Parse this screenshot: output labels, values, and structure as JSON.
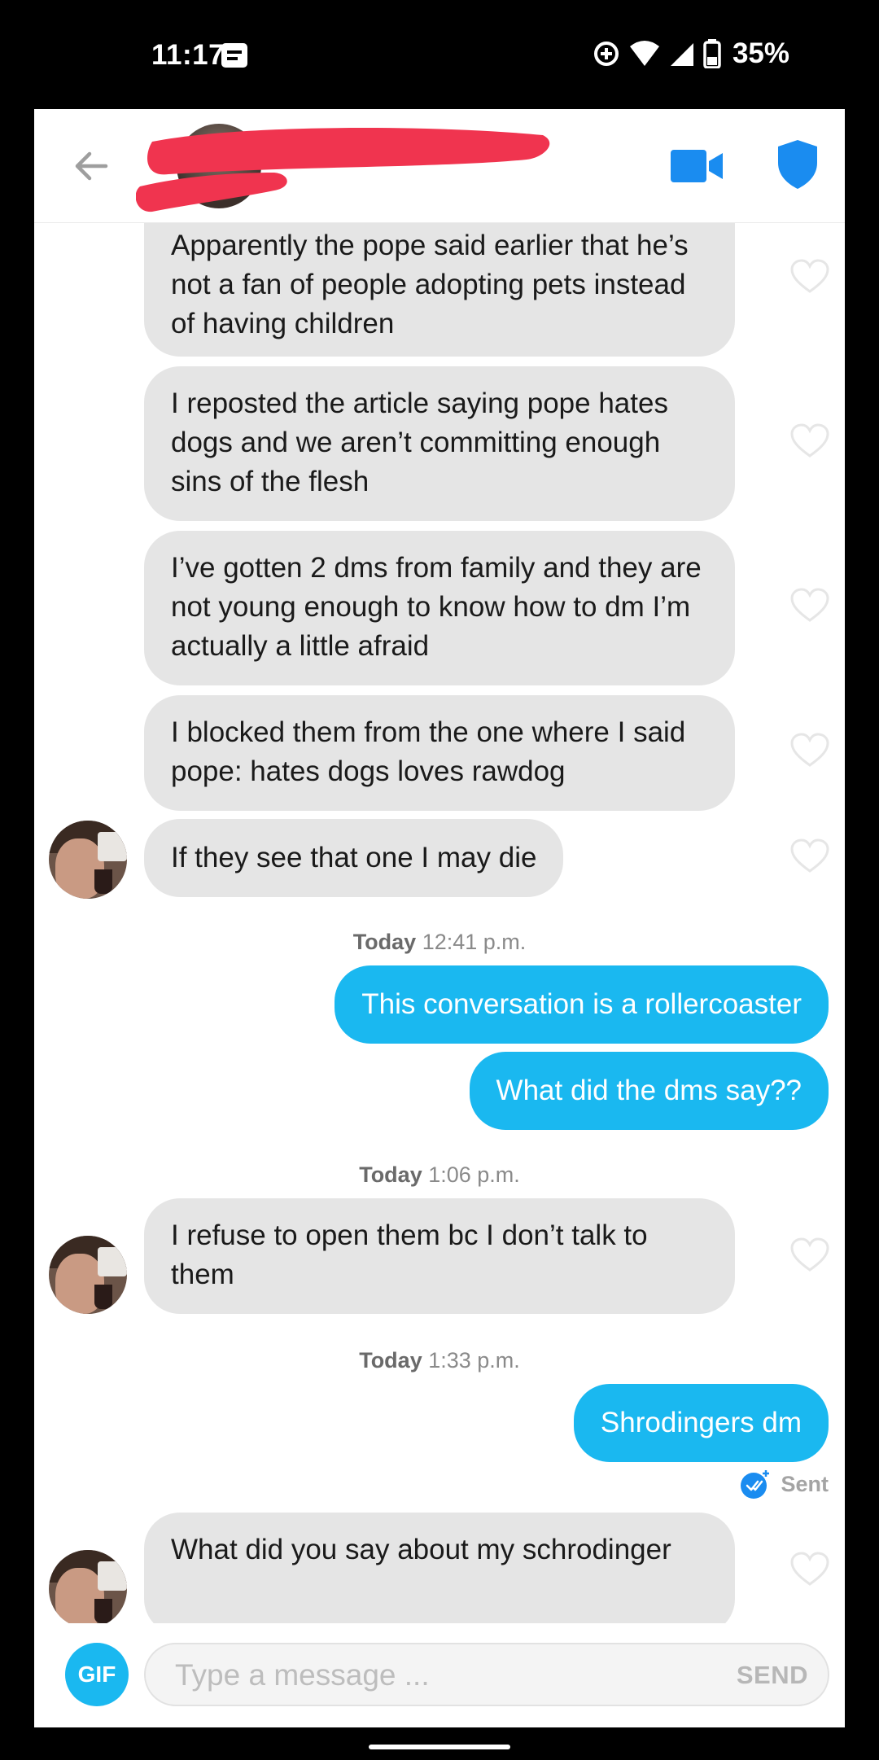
{
  "status_bar": {
    "time": "11:17",
    "battery": "35%"
  },
  "header": {
    "back_icon": "arrow-left-icon",
    "video_icon": "video-camera-icon",
    "safety_icon": "shield-icon",
    "accent_color": "#1a8cf0"
  },
  "messages": {
    "m1": "Apparently the pope said earlier that he’s not a fan of people adopting pets instead of having children",
    "m2": "I reposted the article saying pope hates dogs and we aren’t committing enough sins of the flesh",
    "m3": "I’ve gotten 2 dms from family and they are not young enough to know how to dm I’m actually a little afraid",
    "m4": "I blocked them from the one where I said pope: hates dogs loves rawdog",
    "m5": "If they see that one I may die",
    "ts1_day": "Today",
    "ts1_time": "12:41 p.m.",
    "m6": "This conversation is a rollercoaster",
    "m7": "What did the dms say??",
    "ts2_day": "Today",
    "ts2_time": "1:06 p.m.",
    "m8": "I refuse to open them bc I don’t talk to them",
    "ts3_day": "Today",
    "ts3_time": "1:33 p.m.",
    "m9": "Shrodingers dm",
    "sent_label": "Sent",
    "m10": "What did you say about my schrodinger"
  },
  "composer": {
    "gif_label": "GIF",
    "placeholder": "Type a message ...",
    "send_label": "SEND"
  },
  "colors": {
    "incoming_bubble": "#e5e5e5",
    "outgoing_bubble": "#1ab8f0",
    "redaction": "#f0344f"
  }
}
